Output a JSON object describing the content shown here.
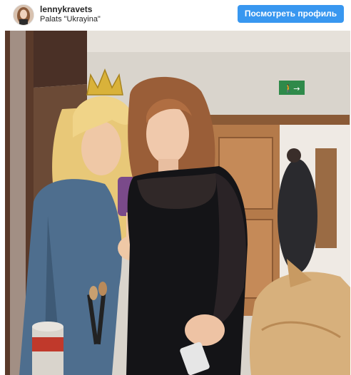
{
  "post": {
    "username": "lennykravets",
    "location": "Palats \"Ukrayina\"",
    "view_profile_label": "Посмотреть профиль"
  },
  "photo": {
    "exit_sign": "🚶→"
  },
  "colors": {
    "button": "#3897f0",
    "text": "#262626"
  }
}
